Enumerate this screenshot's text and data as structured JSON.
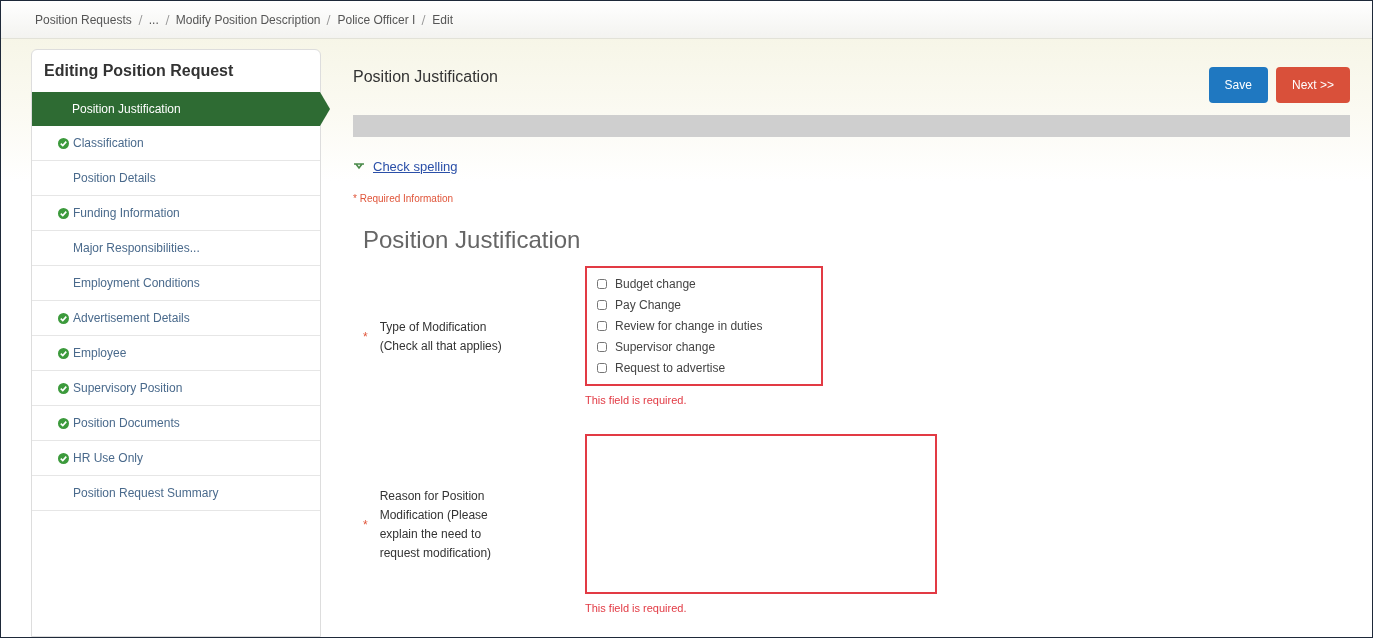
{
  "breadcrumb": [
    "Position Requests",
    "...",
    "Modify Position Description",
    "Police Officer I",
    "Edit"
  ],
  "sidebar": {
    "title": "Editing Position Request",
    "items": [
      {
        "label": "Position Justification",
        "selected": true,
        "completed": false
      },
      {
        "label": "Classification",
        "selected": false,
        "completed": true
      },
      {
        "label": "Position Details",
        "selected": false,
        "completed": false
      },
      {
        "label": "Funding Information",
        "selected": false,
        "completed": true
      },
      {
        "label": "Major Responsibilities...",
        "selected": false,
        "completed": false
      },
      {
        "label": "Employment Conditions",
        "selected": false,
        "completed": false
      },
      {
        "label": "Advertisement Details",
        "selected": false,
        "completed": true
      },
      {
        "label": "Employee",
        "selected": false,
        "completed": true
      },
      {
        "label": "Supervisory Position",
        "selected": false,
        "completed": true
      },
      {
        "label": "Position Documents",
        "selected": false,
        "completed": true
      },
      {
        "label": "HR Use Only",
        "selected": false,
        "completed": true
      },
      {
        "label": "Position Request Summary",
        "selected": false,
        "completed": false
      }
    ]
  },
  "header": {
    "title": "Position Justification",
    "buttons": [
      {
        "label": "Save",
        "kind": "primary"
      },
      {
        "label": "Next >>",
        "kind": "danger"
      }
    ]
  },
  "check_spelling": "Check spelling",
  "required_note": "* Required Information",
  "section_title": "Position Justification",
  "fields": [
    {
      "kind": "checkboxes",
      "required_mark": "*",
      "label": "Type of Modification (Check all that applies)",
      "options": [
        {
          "label": "Budget change",
          "checked": false
        },
        {
          "label": "Pay Change",
          "checked": false
        },
        {
          "label": "Review for change in duties",
          "checked": false
        },
        {
          "label": "Supervisor change",
          "checked": false
        },
        {
          "label": "Request to advertise",
          "checked": false
        }
      ],
      "error": "This field is required."
    },
    {
      "kind": "textarea",
      "required_mark": "*",
      "label": "Reason for Position Modification (Please explain the need to request modification)",
      "error": "This field is required."
    }
  ]
}
